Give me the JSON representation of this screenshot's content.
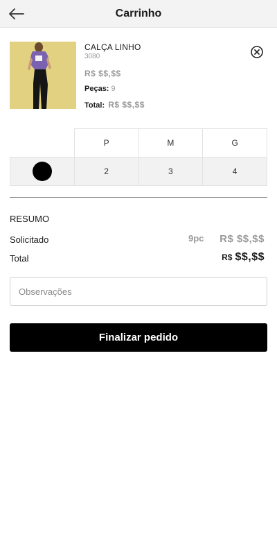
{
  "header": {
    "title": "Carrinho",
    "back_icon": "arrow-left-icon"
  },
  "product": {
    "name": "CALÇA LINHO",
    "ref": "3080",
    "price": "R$ $$,$$",
    "pieces_label": "Peças:",
    "pieces_value": "9",
    "total_label": "Total:",
    "total_value": "R$ $$,$$",
    "remove_icon": "close-circle-icon",
    "image": "model-photo"
  },
  "grid": {
    "sizes": [
      "P",
      "M",
      "G"
    ],
    "color": "#000000",
    "quantities": [
      "2",
      "3",
      "4"
    ]
  },
  "summary": {
    "title": "RESUMO",
    "requested_label": "Solicitado",
    "requested_qty": "9pc",
    "requested_value": "R$ $$,$$",
    "total_label": "Total",
    "total_currency": "R$",
    "total_amount": "$$,$$"
  },
  "notes": {
    "placeholder": "Observações"
  },
  "submit": {
    "label": "Finalizar pedido"
  },
  "colors": {
    "header_bg": "#f3f3f3",
    "product_bg": "#e2d181",
    "muted": "#999999",
    "button_bg": "#000000"
  }
}
